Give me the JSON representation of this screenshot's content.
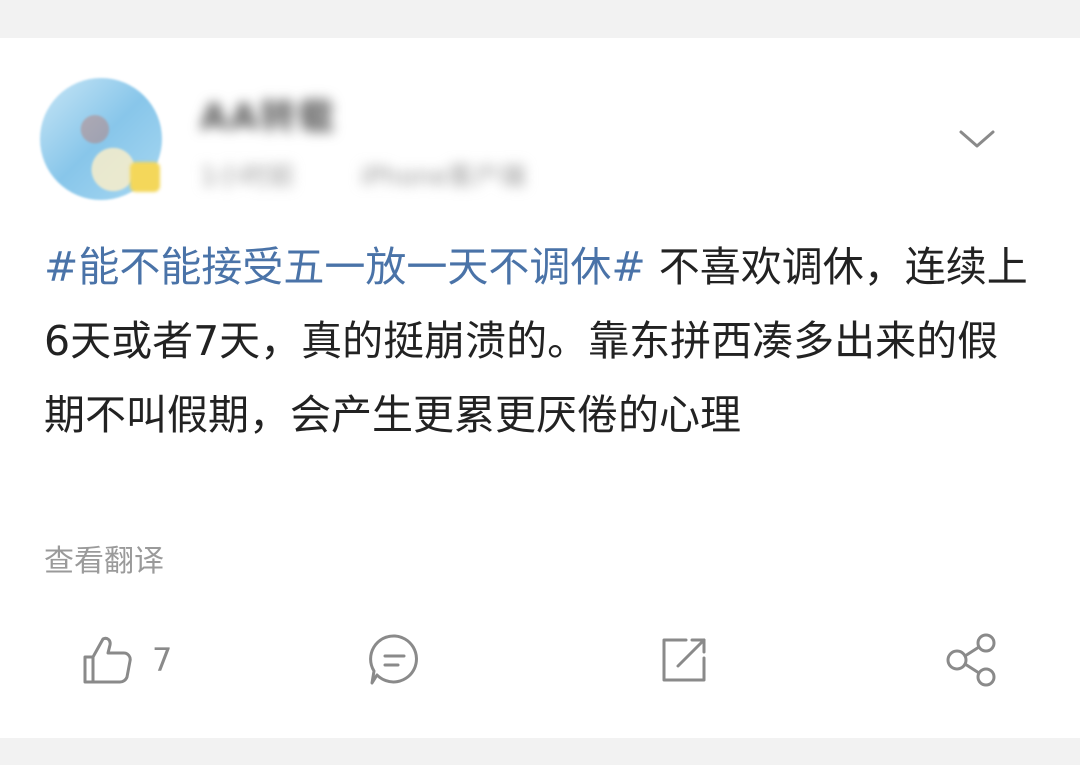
{
  "post": {
    "author": {
      "name": "AA转载"
    },
    "meta": {
      "time": "1小时前",
      "device": "iPhone客户端"
    },
    "hashtag": "#能不能接受五一放一天不调休#",
    "body": " 不喜欢调休，连续上6天或者7天，真的挺崩溃的。靠东拼西凑多出来的假期不叫假期，会产生更累更厌倦的心理",
    "translate_label": "查看翻译"
  },
  "actions": {
    "like_count": "7",
    "icons": {
      "like": "thumbs-up-icon",
      "comment": "comment-icon",
      "repost": "repost-icon",
      "share": "share-icon",
      "more": "chevron-down-icon"
    }
  },
  "colors": {
    "hashtag": "#4a73a8",
    "text": "#222222",
    "muted": "#9a9a9a",
    "background": "#f2f2f2"
  }
}
